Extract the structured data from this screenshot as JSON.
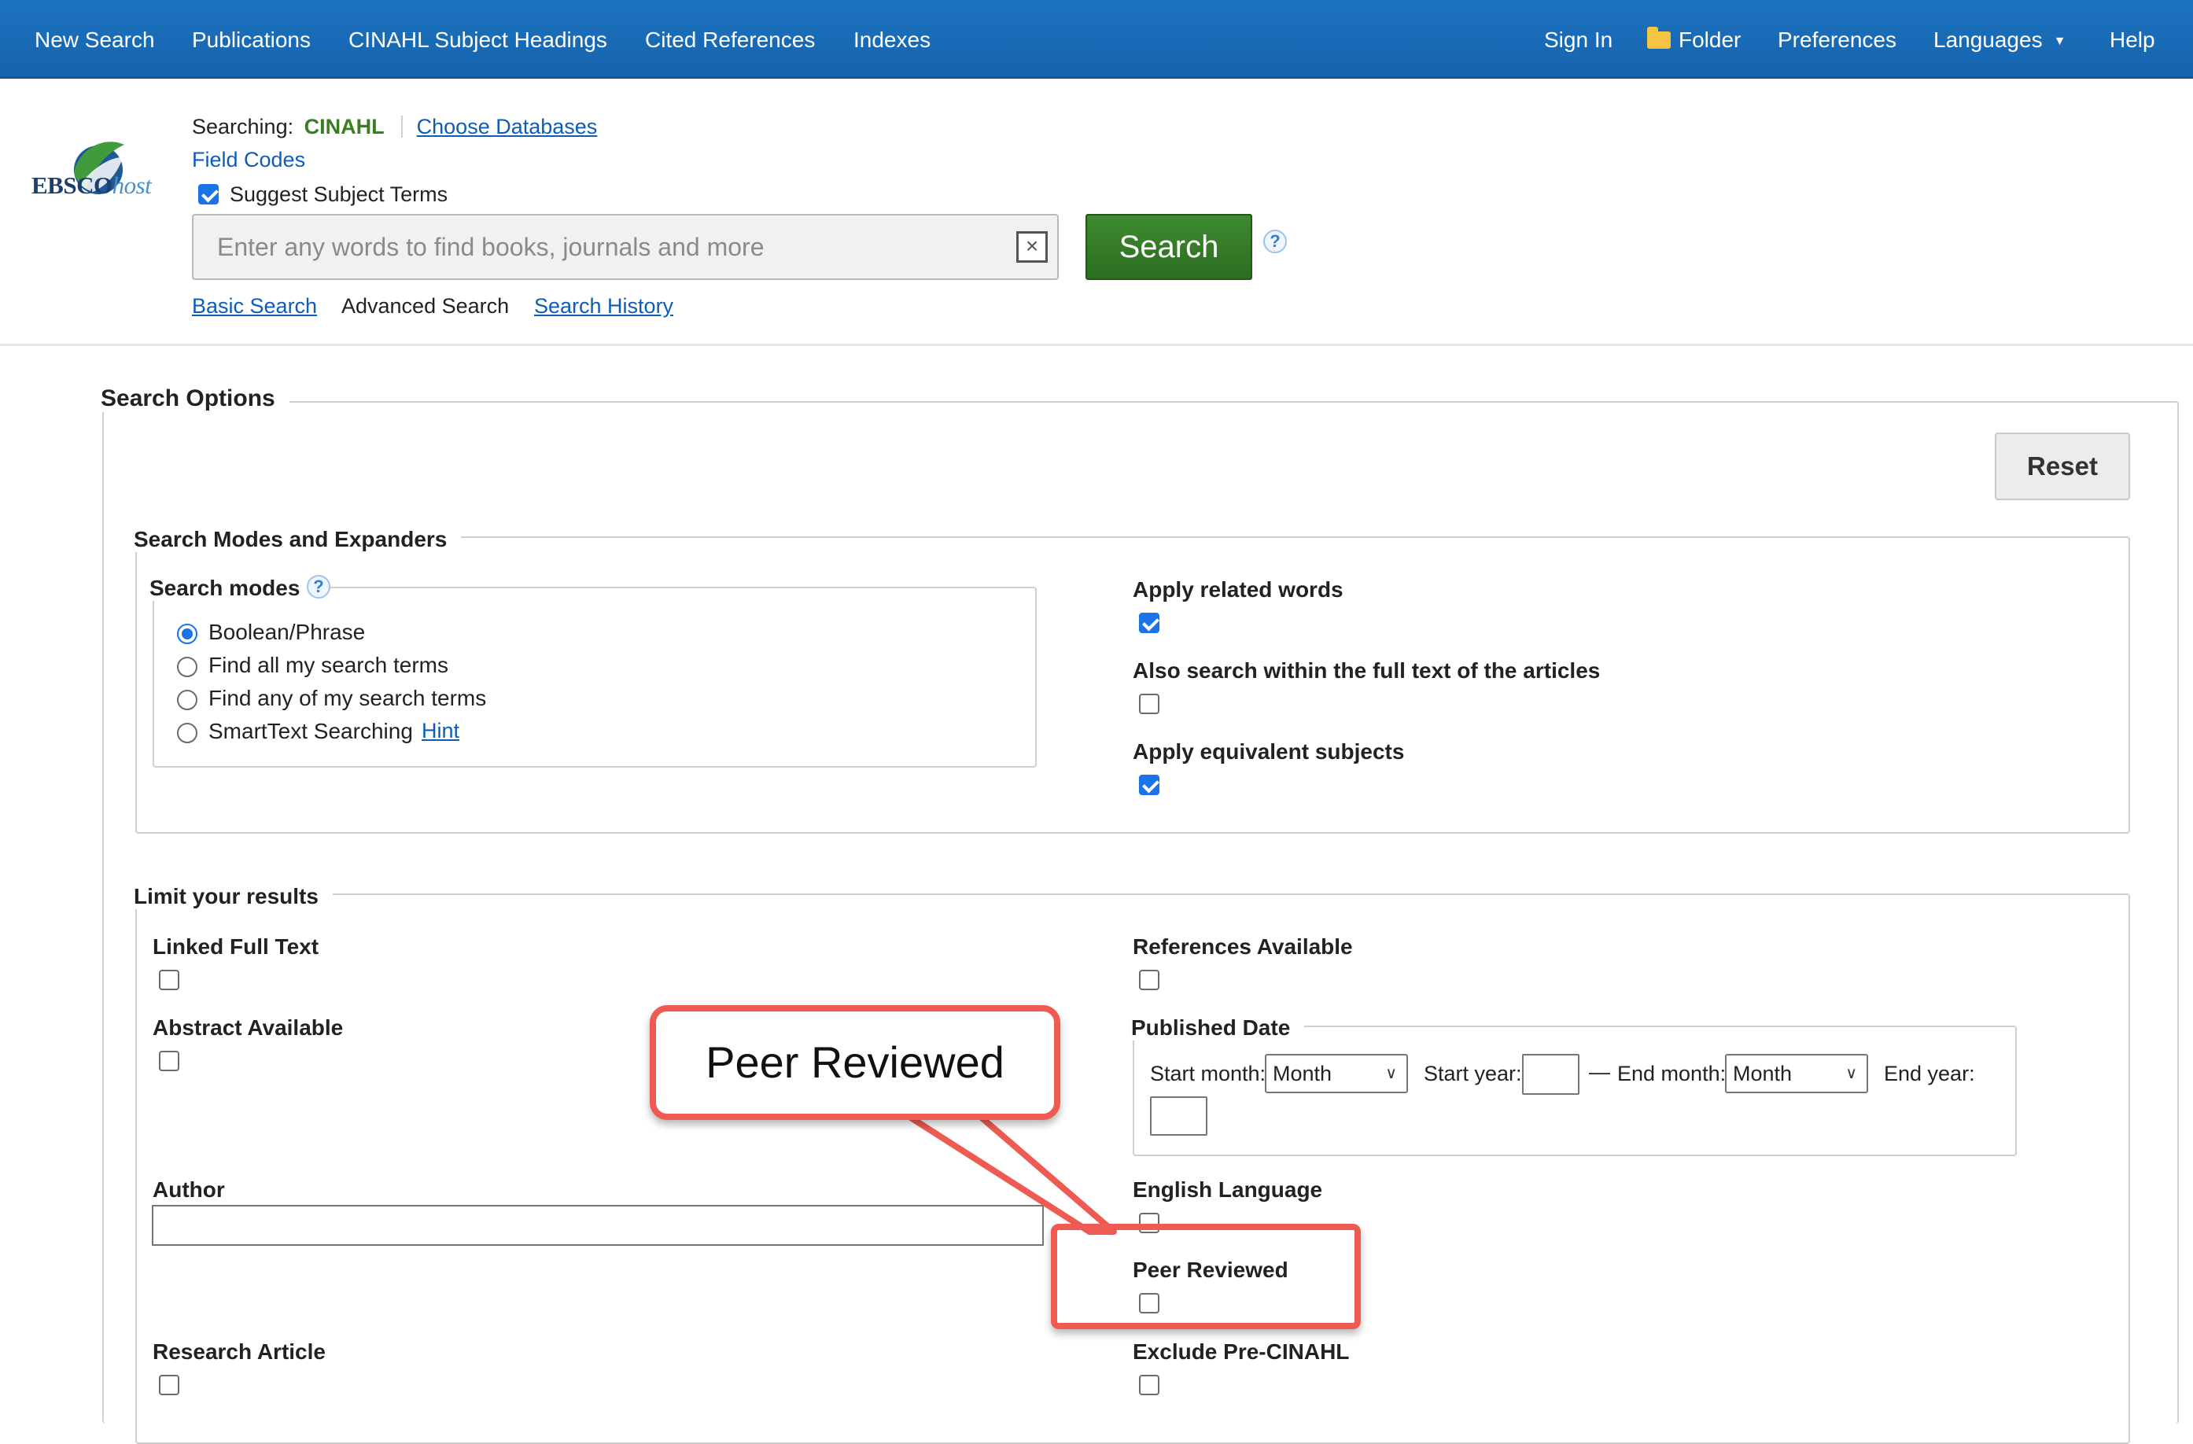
{
  "nav": {
    "left": [
      "New Search",
      "Publications",
      "CINAHL Subject Headings",
      "Cited References",
      "Indexes"
    ],
    "sign_in": "Sign In",
    "folder": "Folder",
    "preferences": "Preferences",
    "languages": "Languages",
    "help": "Help"
  },
  "header": {
    "logo_main": "EBSCO",
    "logo_suffix": "host",
    "searching_label": "Searching:",
    "database": "CINAHL",
    "choose_databases": "Choose Databases",
    "field_codes": "Field Codes",
    "suggest_subject_terms": "Suggest Subject Terms",
    "suggest_checked": true,
    "search_placeholder": "Enter any words to find books, journals and more",
    "search_button": "Search",
    "help_glyph": "?",
    "clear_glyph": "×",
    "links": {
      "basic_search": "Basic Search",
      "advanced_search": "Advanced Search",
      "search_history": "Search History"
    }
  },
  "search_options": {
    "title": "Search Options",
    "reset": "Reset",
    "modes_and_expanders": {
      "title": "Search Modes and Expanders",
      "search_modes": {
        "title": "Search modes",
        "options": [
          {
            "label": "Boolean/Phrase",
            "selected": true
          },
          {
            "label": "Find all my search terms",
            "selected": false
          },
          {
            "label": "Find any of my search terms",
            "selected": false
          },
          {
            "label": "SmartText Searching",
            "selected": false
          }
        ],
        "hint": "Hint"
      },
      "expanders": [
        {
          "label": "Apply related words",
          "checked": true
        },
        {
          "label": "Also search within the full text of the articles",
          "checked": false
        },
        {
          "label": "Apply equivalent subjects",
          "checked": true
        }
      ]
    },
    "limits": {
      "title": "Limit your results",
      "linked_full_text": "Linked Full Text",
      "abstract_available": "Abstract Available",
      "author": "Author",
      "research_article": "Research Article",
      "references_available": "References Available",
      "published_date": {
        "title": "Published Date",
        "start_month": "Start month:",
        "month_value": "Month",
        "start_year": "Start year:",
        "dash": "—",
        "end_month": "End month:",
        "end_month_value": "Month",
        "end_year": "End year:"
      },
      "english_language": "English Language",
      "peer_reviewed": "Peer Reviewed",
      "exclude_pre_cinahl": "Exclude Pre-CINAHL"
    }
  },
  "annotation": {
    "callout_text": "Peer Reviewed",
    "color": "#ee5b52"
  },
  "colors": {
    "nav_bg": "#1d73c0",
    "search_button": "#3f8a30",
    "database_text": "#3a7d22",
    "link": "#0d5db8"
  }
}
